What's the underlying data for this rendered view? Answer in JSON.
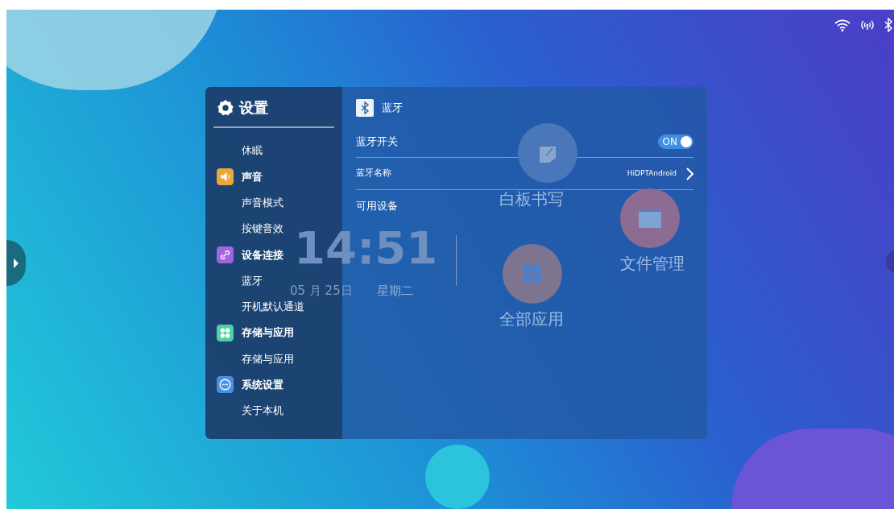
{
  "desktop": {
    "clock": "14:51",
    "date": "05 月 25日",
    "weekday": "星期二",
    "apps": [
      {
        "label": "白板书写",
        "kind": "whiteboard"
      },
      {
        "label": "文件管理",
        "kind": "files"
      },
      {
        "label": "全部应用",
        "kind": "all"
      }
    ]
  },
  "settings": {
    "title": "设置",
    "menu": [
      {
        "label": "休眠",
        "kind": "item"
      },
      {
        "label": "声音",
        "kind": "section",
        "color": "#e8a93a"
      },
      {
        "label": "声音模式",
        "kind": "item"
      },
      {
        "label": "按键音效",
        "kind": "item"
      },
      {
        "label": "设备连接",
        "kind": "section",
        "color": "#a066e0"
      },
      {
        "label": "蓝牙",
        "kind": "item"
      },
      {
        "label": "开机默认通道",
        "kind": "item"
      },
      {
        "label": "存储与应用",
        "kind": "section",
        "color": "#4fd1a8"
      },
      {
        "label": "存储与应用",
        "kind": "item"
      },
      {
        "label": "系统设置",
        "kind": "section",
        "color": "#4a90e2"
      },
      {
        "label": "关于本机",
        "kind": "item"
      }
    ],
    "page": {
      "title": "蓝牙",
      "rows": [
        {
          "label": "蓝牙开关",
          "kind": "toggle",
          "on": true,
          "toggle_text": "ON"
        },
        {
          "label": "蓝牙名称",
          "kind": "link",
          "value": "HiDPTAndroid"
        },
        {
          "label": "可用设备",
          "kind": "header"
        }
      ]
    }
  }
}
